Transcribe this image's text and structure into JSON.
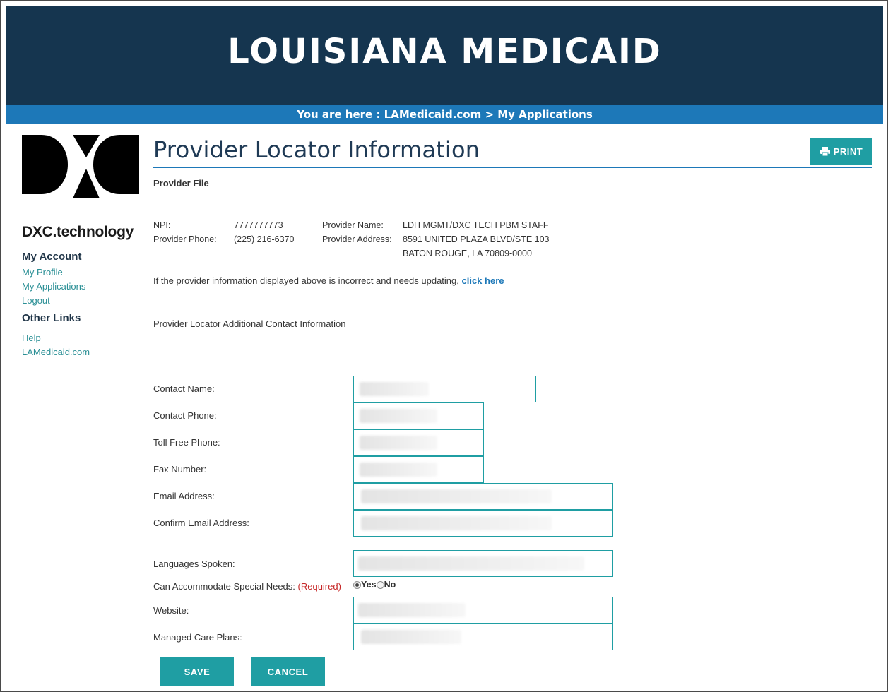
{
  "header": {
    "title": "LOUISIANA MEDICAID",
    "breadcrumb": "You are here : LAMedicaid.com > My Applications"
  },
  "sidebar": {
    "logo_text": "DXC.technology",
    "my_account": {
      "heading": "My Account",
      "links": [
        "My Profile",
        "My Applications",
        "Logout"
      ]
    },
    "other_links": {
      "heading": "Other Links",
      "links": [
        "Help",
        "LAMedicaid.com"
      ]
    }
  },
  "page": {
    "title": "Provider Locator Information",
    "print_label": "PRINT",
    "subheading": "Provider File",
    "provider": {
      "npi_label": "NPI:",
      "npi_value": "7777777773",
      "phone_label": "Provider Phone:",
      "phone_value": "(225) 216-6370",
      "name_label": "Provider Name:",
      "name_value": "LDH MGMT/DXC TECH PBM STAFF",
      "address_label": "Provider Address:",
      "address_line1": "8591 UNITED PLAZA BLVD/STE 103",
      "address_line2": "BATON ROUGE, LA 70809-0000"
    },
    "note_text": "If the provider information displayed above is incorrect and needs updating,",
    "note_link": "click here",
    "section_label": "Provider Locator Additional Contact Information"
  },
  "form": {
    "contact_name": "Contact Name:",
    "contact_phone": "Contact Phone:",
    "toll_free": "Toll Free Phone:",
    "fax": "Fax Number:",
    "email": "Email Address:",
    "confirm_email": "Confirm Email Address:",
    "languages": "Languages Spoken:",
    "special_needs": "Can Accommodate Special Needs:",
    "required": "(Required)",
    "yes": "Yes",
    "no": "No",
    "special_needs_value": "Yes",
    "website": "Website:",
    "managed_care": "Managed Care Plans:"
  },
  "buttons": {
    "save": "SAVE",
    "cancel": "CANCEL"
  },
  "colors": {
    "banner": "#15354f",
    "breadcrumb_bar": "#1d78b8",
    "accent": "#1f9ea3",
    "required": "#c62828"
  }
}
